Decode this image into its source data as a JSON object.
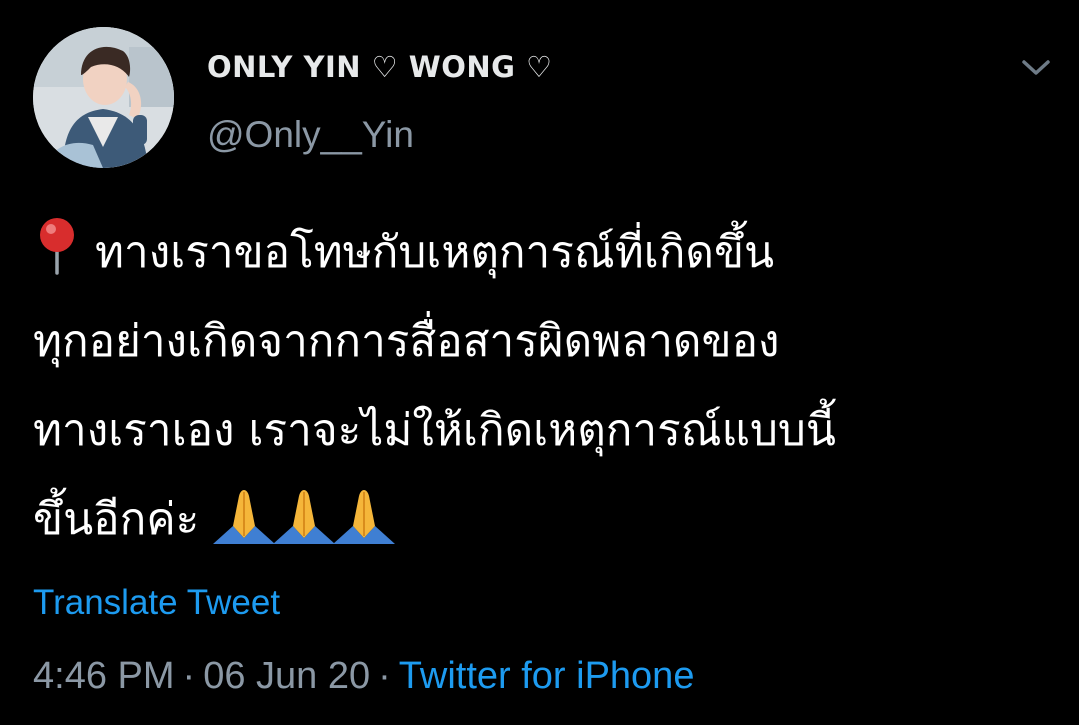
{
  "user": {
    "display_name": "ONLY YIN ♡ WONG ♡",
    "handle": "@Only__Yin"
  },
  "tweet": {
    "lines": [
      "ทางเราขอโทษกับเหตุการณ์ที่เกิดขึ้น",
      "ทุกอย่างเกิดจากการสื่อสารผิดพลาดของ",
      "ทางเราเอง เราจะไม่ให้เกิดเหตุการณ์แบบนี้",
      "ขึ้นอีกค่ะ"
    ],
    "leading_emoji": "round-pushpin-icon",
    "trailing_emoji": [
      "folded-hands-icon",
      "folded-hands-icon",
      "folded-hands-icon"
    ]
  },
  "translate_label": "Translate Tweet",
  "meta": {
    "time": "4:46 PM",
    "separator": "·",
    "date": "06 Jun 20",
    "source": "Twitter for iPhone"
  },
  "colors": {
    "background": "#000000",
    "text": "#ffffff",
    "secondary": "#8b98a5",
    "link": "#1d9bf0"
  }
}
